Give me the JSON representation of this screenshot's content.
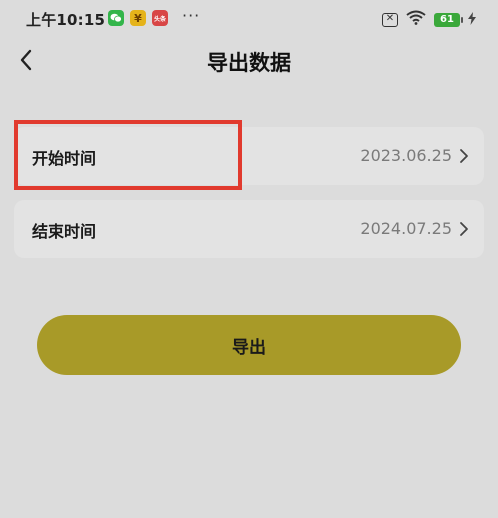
{
  "status_bar": {
    "time": "上午10:15",
    "yen_icon_glyph": "¥",
    "toutiao_icon_text": "头条",
    "more": "···",
    "sim_icon_glyph": "✕",
    "battery": "61",
    "wifi_icon": "wifi-icon",
    "charging_icon": "bolt-icon"
  },
  "header": {
    "title": "导出数据",
    "back_icon": "chevron-left-icon"
  },
  "rows": [
    {
      "label": "开始时间",
      "value": "2023.06.25"
    },
    {
      "label": "结束时间",
      "value": "2024.07.25"
    }
  ],
  "export_button": {
    "label": "导出"
  },
  "colors": {
    "background": "#dcdcdc",
    "row_background": "#e3e3e3",
    "button_background": "#a89a28",
    "highlight": "#e13a2e",
    "value_text": "#7a7a7a"
  }
}
